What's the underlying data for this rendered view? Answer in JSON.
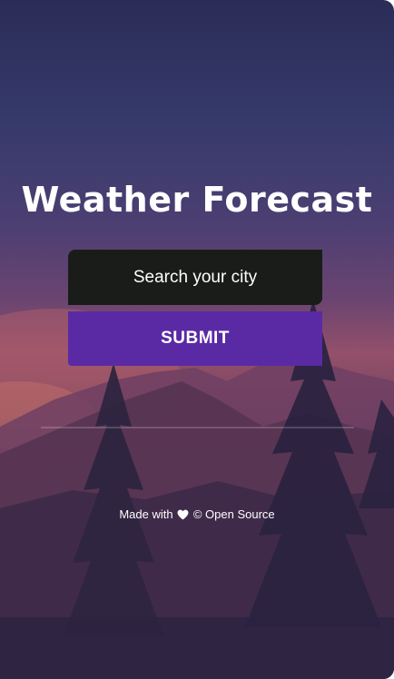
{
  "app": {
    "title": "Weather Forecast"
  },
  "search": {
    "placeholder": "Search your city",
    "value": ""
  },
  "actions": {
    "submit_label": "SUBMIT"
  },
  "footer": {
    "made_with": "Made with",
    "heart_icon": "heart-icon",
    "copyright": "©",
    "source": "Open Source"
  },
  "colors": {
    "button": "#5a2aa5",
    "input_bg": "#1a1c1a",
    "text": "#ffffff"
  }
}
